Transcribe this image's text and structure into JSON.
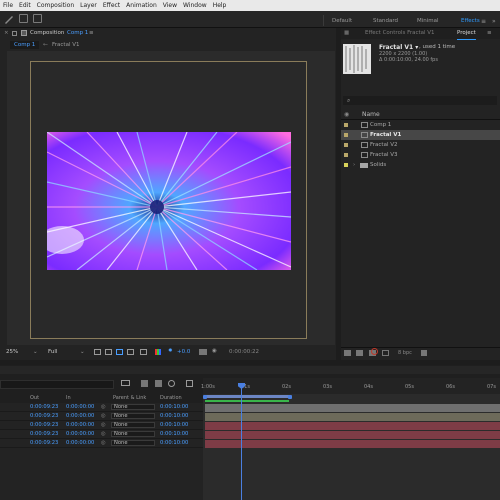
{
  "menu": [
    "File",
    "Edit",
    "Composition",
    "Layer",
    "Effect",
    "Animation",
    "View",
    "Window",
    "Help"
  ],
  "workspaces": [
    {
      "label": "Default",
      "active": false
    },
    {
      "label": "Standard",
      "active": false
    },
    {
      "label": "Minimal",
      "active": false
    },
    {
      "label": "Effects",
      "active": true
    }
  ],
  "composition": {
    "tab_prefix": "Composition",
    "tab_name": "Comp 1",
    "subtabs": [
      "Comp 1",
      "Fractal V1"
    ],
    "zoom": "25%",
    "resolution": "Full",
    "exposure": "+0.0",
    "timecode": "0:00:00:22"
  },
  "project": {
    "tab_effect_controls": "Effect Controls Fractal V1",
    "tab_project": "Project",
    "item_name": "Fractal V1 ▾",
    "item_used": ", used 1 time",
    "item_size": "2200 x 2200 (1.00)",
    "item_duration": "Δ 0:00:10:00, 24.00 fps",
    "search_icon": "⌕",
    "column_name": "Name",
    "items": [
      {
        "name": "Comp 1",
        "tag": "#b9a76a",
        "selected": false,
        "type": "comp"
      },
      {
        "name": "Fractal V1",
        "tag": "#b9a76a",
        "selected": true,
        "type": "comp"
      },
      {
        "name": "Fractal V2",
        "tag": "#b9a76a",
        "selected": false,
        "type": "comp"
      },
      {
        "name": "Fractal V3",
        "tag": "#b9a76a",
        "selected": false,
        "type": "comp"
      },
      {
        "name": "Solids",
        "tag": "#d8d35a",
        "selected": false,
        "type": "folder"
      }
    ],
    "bpc": "8 bpc"
  },
  "timeline": {
    "ruler": [
      "1:00s",
      "01s",
      "02s",
      "03s",
      "04s",
      "05s",
      "06s",
      "07s"
    ],
    "columns": {
      "out": "Out",
      "in": "In",
      "parent": "Parent & Link",
      "duration": "Duration"
    },
    "rows": [
      {
        "out": "0:00:09:23",
        "in": "0:00:00:00",
        "parent": "None",
        "duration": "0:00:10:00",
        "bar": "#6f6f6f"
      },
      {
        "out": "0:00:09:23",
        "in": "0:00:00:00",
        "parent": "None",
        "duration": "0:00:10:00",
        "bar": "#6d6a5a"
      },
      {
        "out": "0:00:09:23",
        "in": "0:00:00:00",
        "parent": "None",
        "duration": "0:00:10:00",
        "bar": "#7e3c46"
      },
      {
        "out": "0:00:09:23",
        "in": "0:00:00:00",
        "parent": "None",
        "duration": "0:00:10:00",
        "bar": "#7e3c46"
      },
      {
        "out": "0:00:09:23",
        "in": "0:00:00:00",
        "parent": "None",
        "duration": "0:00:10:00",
        "bar": "#7e3c46"
      }
    ]
  },
  "colors": {
    "accent": "#2f9bff",
    "work_area": "#6c86c4",
    "playhead": "#4a7fe0"
  }
}
